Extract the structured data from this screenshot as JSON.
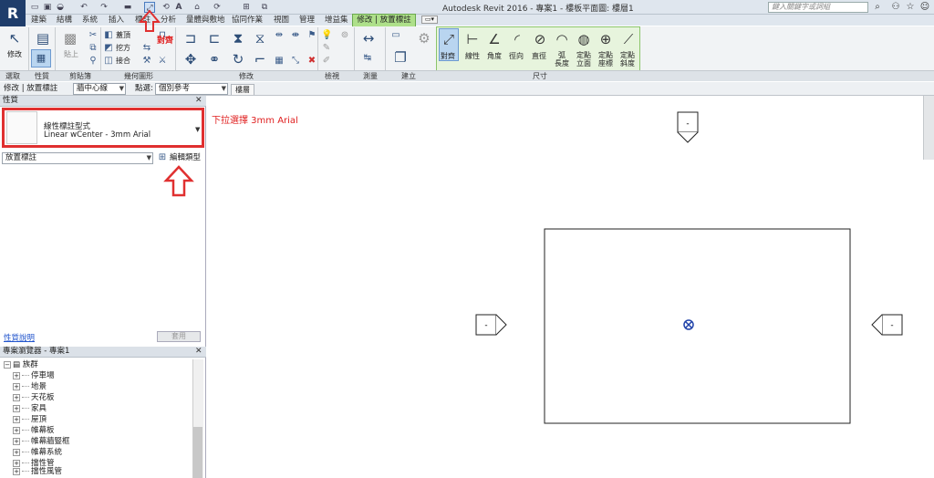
{
  "app_logo": "R",
  "title": "Autodesk Revit 2016 -    專案1 - 樓板平面圖: 樓層1",
  "search_placeholder": "鍵入關鍵字或詞組",
  "tabs": [
    "建築",
    "結構",
    "系統",
    "插入",
    "標註",
    "分析",
    "量體與敷地",
    "協同作業",
    "視圖",
    "管理",
    "增益集"
  ],
  "active_tab": "修改 | 放置標註",
  "ribbon": {
    "modify_label": "修改",
    "select_panel": "選取",
    "properties_panel": "性質",
    "clipboard_panel": "剪貼簿",
    "geometry_panel": "幾何圖形",
    "modify_panel": "修改",
    "view_panel": "檢視",
    "measure_panel": "測量",
    "create_panel": "建立",
    "dimension_panel": "尺寸",
    "paste_label": "貼上",
    "cope": "蓋頂",
    "cut": "挖方",
    "join": "接合",
    "aligned_annotation": "對齊",
    "dim_buttons": [
      {
        "label": "對齊",
        "icon": "aligned-dimension-icon"
      },
      {
        "label": "線性",
        "icon": "linear-dimension-icon"
      },
      {
        "label": "角度",
        "icon": "angular-dimension-icon"
      },
      {
        "label": "徑向",
        "icon": "radial-dimension-icon"
      },
      {
        "label": "直徑",
        "icon": "diameter-dimension-icon"
      },
      {
        "label": "弧\n長度",
        "icon": "arc-length-dimension-icon"
      },
      {
        "label": "定點\n立面",
        "icon": "spot-elevation-icon"
      },
      {
        "label": "定點\n座標",
        "icon": "spot-coordinate-icon"
      },
      {
        "label": "定點\n斜度",
        "icon": "spot-slope-icon"
      }
    ]
  },
  "options_bar": {
    "context": "修改 | 放置標註",
    "placement": "牆中心線",
    "pick_label": "點選:",
    "pick_value": "個別參考"
  },
  "view_tab": "樓層",
  "properties": {
    "header": "性質",
    "family": "線性標註型式",
    "type": "Linear wCenter - 3mm Arial",
    "instance": "放置標註",
    "edit_type": "編輯類型",
    "help": "性質說明",
    "apply": "套用"
  },
  "annotation": "下拉選擇 3mm Arial",
  "browser": {
    "header": "專案瀏覽器 - 專案1",
    "root": "族群",
    "items": [
      "停車場",
      "地景",
      "天花板",
      "家具",
      "屋頂",
      "帷幕板",
      "帷幕牆豎框",
      "帷幕系統",
      "擋性管",
      "擋性風管"
    ]
  },
  "elevation_marker": "-",
  "colors": {
    "accent_green": "#aee08a",
    "highlight_red": "#e03030"
  }
}
